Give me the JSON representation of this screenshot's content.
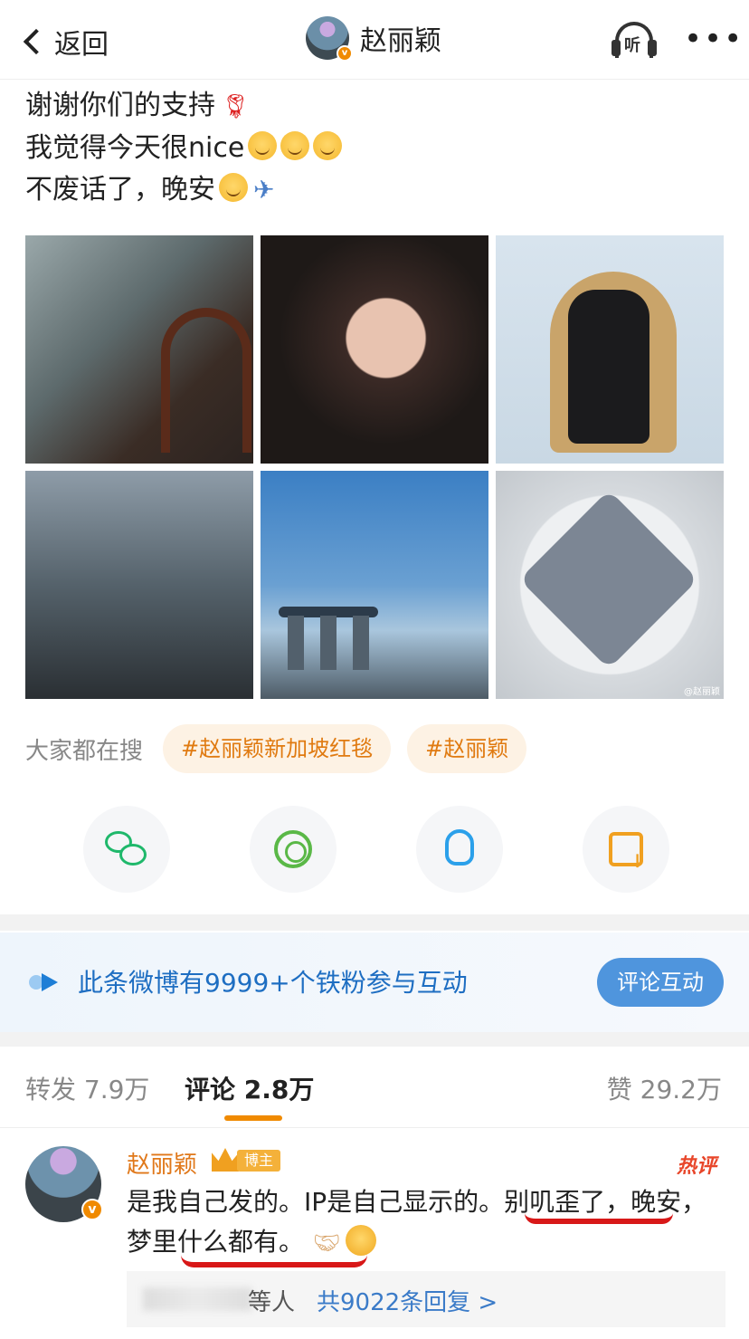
{
  "header": {
    "back_label": "返回",
    "title": "赵丽颖",
    "listen_label": "听",
    "more_label": "•••"
  },
  "post": {
    "lines": [
      "谢谢你们的支持",
      "我觉得今天很nice",
      "不废话了，晚安"
    ],
    "watermark": "@赵丽颖"
  },
  "search": {
    "label": "大家都在搜",
    "tags": [
      "#赵丽颖新加坡红毯",
      "#赵丽颖"
    ]
  },
  "share": {
    "icons": [
      "wechat-icon",
      "moments-icon",
      "qq-icon",
      "save-image-icon"
    ]
  },
  "fans_banner": {
    "text": "此条微博有9999+个铁粉参与互动",
    "button": "评论互动"
  },
  "tabs": {
    "repost": "转发 7.9万",
    "comment": "评论 2.8万",
    "like": "赞 29.2万"
  },
  "comment": {
    "name": "赵丽颖",
    "host_badge": "博主",
    "hot_badge": "热评",
    "text_part1": "是我自己发的。IP是自己显示的。别叽歪了，晚安，梦里什么都有。",
    "replies_who": "等人",
    "replies_link": "共9022条回复 >"
  },
  "colors": {
    "accent_orange": "#f08a00",
    "link_blue": "#3b7bc8",
    "underline_red": "#d81818"
  }
}
